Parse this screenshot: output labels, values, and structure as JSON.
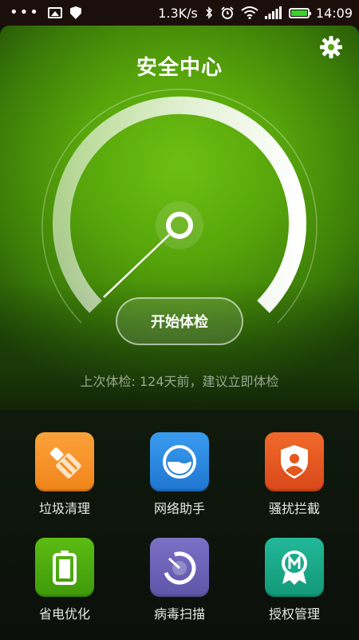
{
  "status_bar": {
    "speed": "1.3K/s",
    "time": "14:09"
  },
  "header": {
    "title": "安全中心"
  },
  "main": {
    "start_button": "开始体检",
    "last_check": "上次体检: 124天前，建议立即体检"
  },
  "tools": [
    {
      "label": "垃圾清理",
      "icon": "broom-icon",
      "color": "#f5901f"
    },
    {
      "label": "网络助手",
      "icon": "network-icon",
      "color": "#2a86dc"
    },
    {
      "label": "骚扰拦截",
      "icon": "block-shield-icon",
      "color": "#e5571c"
    },
    {
      "label": "省电优化",
      "icon": "battery-icon",
      "color": "#4aa80e"
    },
    {
      "label": "病毒扫描",
      "icon": "virus-scan-icon",
      "color": "#6e63b8"
    },
    {
      "label": "授权管理",
      "icon": "permission-badge-icon",
      "color": "#17a98a"
    }
  ]
}
